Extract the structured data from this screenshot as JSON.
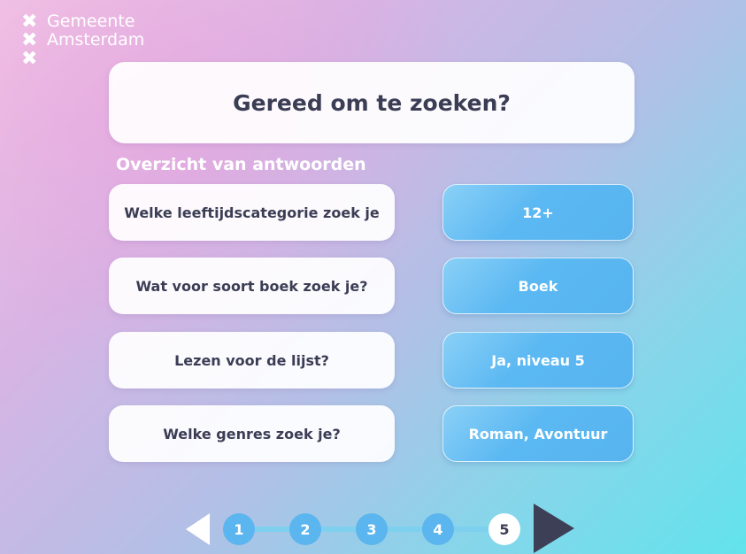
{
  "logo": {
    "cross": "✖",
    "line1": "Gemeente",
    "line2": "Amsterdam"
  },
  "title": "Gereed om te zoeken?",
  "section_label": "Overzicht van antwoorden",
  "answers": [
    {
      "question": "Welke leeftijdscategorie zoek je",
      "answer": "12+"
    },
    {
      "question": "Wat voor soort boek zoek je?",
      "answer": "Boek"
    },
    {
      "question": "Lezen voor de lijst?",
      "answer": "Ja, niveau 5"
    },
    {
      "question": "Welke genres zoek je?",
      "answer": "Roman, Avontuur"
    }
  ],
  "pagination": {
    "steps": [
      "1",
      "2",
      "3",
      "4",
      "5"
    ],
    "current": "5",
    "prev_icon": "triangle-left-icon",
    "next_icon": "triangle-right-icon"
  },
  "colors": {
    "text_dark": "#3b3d55",
    "answer_button": "#5bb8f2",
    "step_done": "#5bb5ef",
    "next_arrow": "#3d3f56"
  }
}
